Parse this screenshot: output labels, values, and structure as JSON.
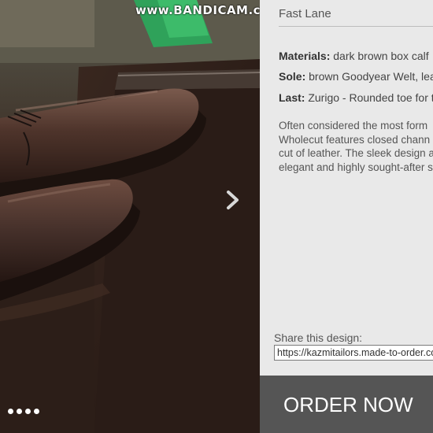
{
  "watermark": "www.BANDICAM.com",
  "product": {
    "name": "Fast Lane",
    "materials_label": "Materials:",
    "materials_value": "dark brown box calf",
    "sole_label": "Sole:",
    "sole_value": "brown Goodyear Welt, lea",
    "last_label": "Last:",
    "last_value": "Zurigo - Rounded toe for tr",
    "description_lines": [
      "Often considered the most form",
      "Wholecut features closed chann",
      "cut of leather. The sleek design a",
      "elegant and highly sought-after s"
    ]
  },
  "share": {
    "label": "Share this design:",
    "url": "https://kazmitailors.made-to-order.co"
  },
  "order_button": "ORDER NOW",
  "carousel": {
    "dot_count": 4,
    "next_icon": "chevron-right-icon"
  },
  "colors": {
    "panel_bg": "#e9e9e9",
    "button_bg": "#555555",
    "button_text": "#ffffff",
    "leather": "#4a3028"
  }
}
